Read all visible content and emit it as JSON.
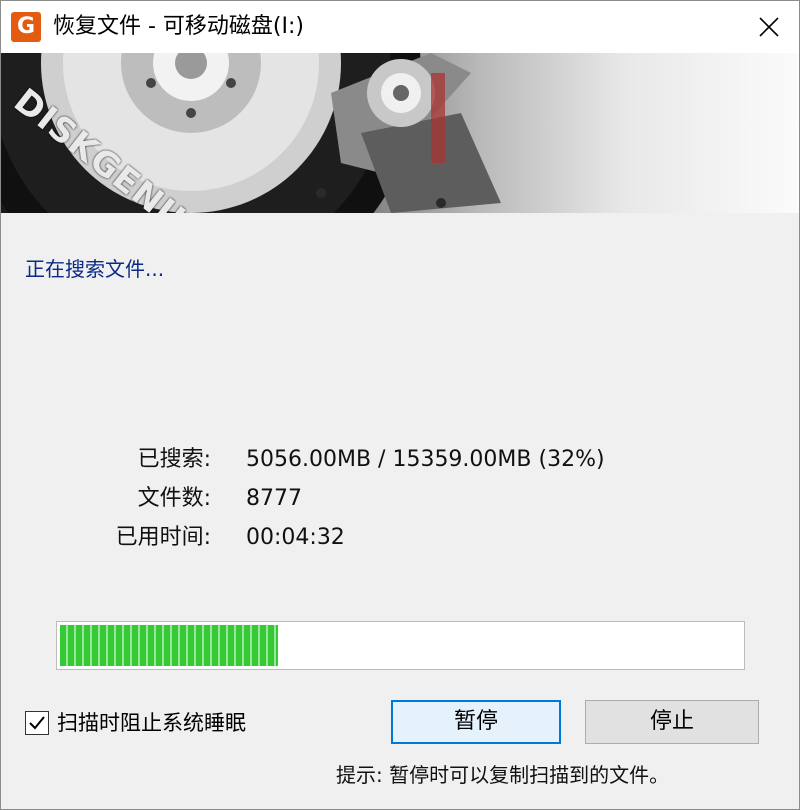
{
  "window": {
    "title": "恢复文件 - 可移动磁盘(I:)",
    "app_icon_glyph": "G"
  },
  "banner": {
    "brand": "DISKGENIUS"
  },
  "status": {
    "text": "正在搜索文件..."
  },
  "stats": [
    {
      "label": "已搜索:",
      "value": "5056.00MB / 15359.00MB (32%)"
    },
    {
      "label": "文件数:",
      "value": "8777"
    },
    {
      "label": "已用时间:",
      "value": "00:04:32"
    }
  ],
  "progress": {
    "fraction": 0.32
  },
  "options": {
    "prevent_sleep_label": "扫描时阻止系统睡眠",
    "prevent_sleep_checked": true
  },
  "buttons": {
    "pause_label": "暂停",
    "stop_label": "停止"
  },
  "hint": {
    "text": "提示: 暂停时可以复制扫描到的文件。"
  },
  "colors": {
    "status_text": "#0a2a86",
    "progress_green": "#35c935",
    "accent_blue": "#0078d7",
    "app_icon_orange": "#e35b10"
  }
}
